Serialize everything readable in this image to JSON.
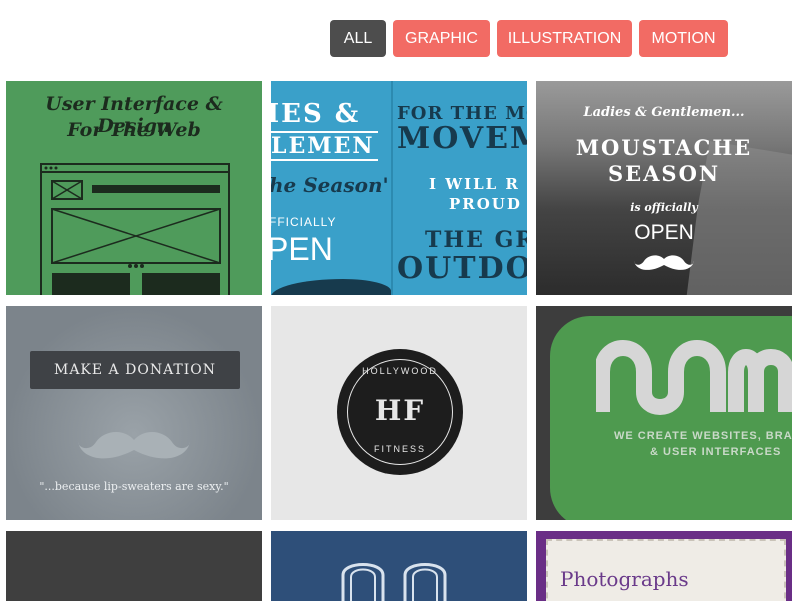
{
  "filters": [
    {
      "label": "ALL",
      "active": true
    },
    {
      "label": "GRAPHIC",
      "active": false
    },
    {
      "label": "ILLUSTRATION",
      "active": false
    },
    {
      "label": "MOTION",
      "active": false
    }
  ],
  "tiles": {
    "t1": {
      "title_line1": "User Interface & Design",
      "title_line2": "For The Web"
    },
    "t2": {
      "l1": "IES &",
      "l2": "LEMEN",
      "l3": "he Season'",
      "l4": "FFICIALLY",
      "l5": "PEN",
      "r1": "FOR THE MO",
      "r2": "MOVEM",
      "r3": "I WILL R",
      "r4": "PROUD",
      "r5": "THE GR",
      "r6": "OUTDO"
    },
    "t3": {
      "l1": "Ladies & Gentlemen...",
      "l2": "MOUSTACHE",
      "l3": "SEASON",
      "l4": "is officially",
      "l5": "OPEN"
    },
    "t4": {
      "button": "MAKE A DONATION",
      "quote": "\"...because lip-sweaters are sexy.\""
    },
    "t5": {
      "badge_top": "HOLLYWOOD",
      "badge_mono": "HF",
      "badge_bottom": "FITNESS"
    },
    "t6": {
      "line1": "WE CREATE WEBSITES, BRAN",
      "line2": "& USER INTERFACES"
    },
    "t9": {
      "title": "Photographs"
    }
  },
  "colors": {
    "accent": "#f26b64",
    "active": "#4d4d4d"
  }
}
